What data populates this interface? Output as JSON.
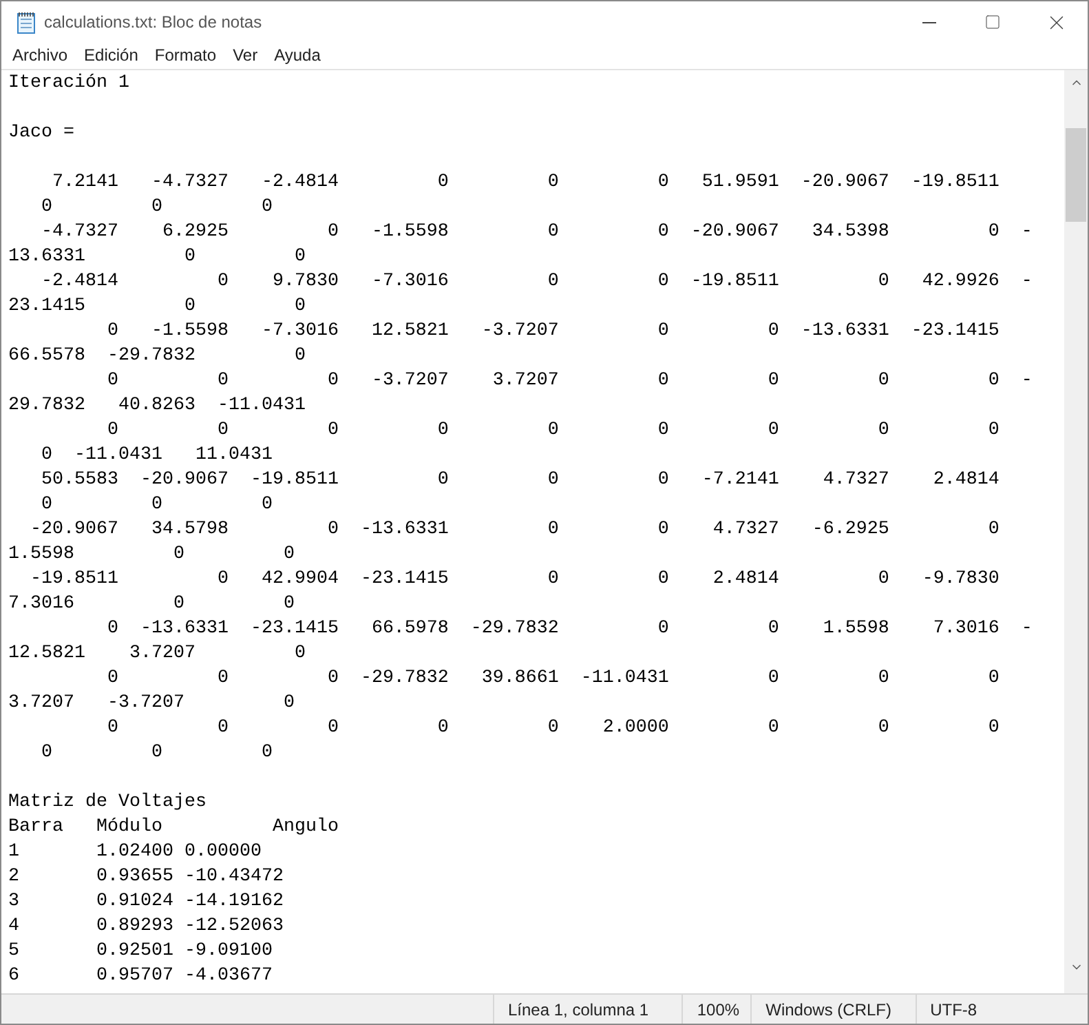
{
  "window": {
    "title": "calculations.txt: Bloc de notas"
  },
  "menu": [
    "Archivo",
    "Edición",
    "Formato",
    "Ver",
    "Ayuda"
  ],
  "editor": {
    "blocks": [
      {
        "lines": [
          "Iteración 1"
        ]
      },
      {
        "lines": [
          "Jaco ="
        ]
      },
      {
        "lines": [
          "    7.2141   -4.7327   -2.4814         0         0         0   51.9591  -20.9067  -19.8511",
          "   0         0         0",
          "   -4.7327    6.2925         0   -1.5598         0         0  -20.9067   34.5398         0  -",
          "13.6331         0         0",
          "   -2.4814         0    9.7830   -7.3016         0         0  -19.8511         0   42.9926  -",
          "23.1415         0         0",
          "         0   -1.5598   -7.3016   12.5821   -3.7207         0         0  -13.6331  -23.1415",
          "66.5578  -29.7832         0",
          "         0         0         0   -3.7207    3.7207         0         0         0         0  -",
          "29.7832   40.8263  -11.0431",
          "         0         0         0         0         0         0         0         0         0",
          "   0  -11.0431   11.0431",
          "   50.5583  -20.9067  -19.8511         0         0         0   -7.2141    4.7327    2.4814",
          "   0         0         0",
          "  -20.9067   34.5798         0  -13.6331         0         0    4.7327   -6.2925         0",
          "1.5598         0         0",
          "  -19.8511         0   42.9904  -23.1415         0         0    2.4814         0   -9.7830",
          "7.3016         0         0",
          "         0  -13.6331  -23.1415   66.5978  -29.7832         0         0    1.5598    7.3016  -",
          "12.5821    3.7207         0",
          "         0         0         0  -29.7832   39.8661  -11.0431         0         0         0",
          "3.7207   -3.7207         0",
          "         0         0         0         0         0    2.0000         0         0         0",
          "   0         0         0"
        ]
      },
      {
        "lines": [
          "Matriz de Voltajes",
          "Barra   Módulo          Angulo",
          "1       1.02400 0.00000",
          "2       0.93655 -10.43472",
          "3       0.91024 -14.19162",
          "4       0.89293 -12.52063",
          "5       0.92501 -9.09100",
          "6       0.95707 -4.03677"
        ]
      }
    ]
  },
  "status_bar": [
    "Línea 1, columna 1",
    "100%",
    "Windows (CRLF)",
    "UTF-8"
  ]
}
